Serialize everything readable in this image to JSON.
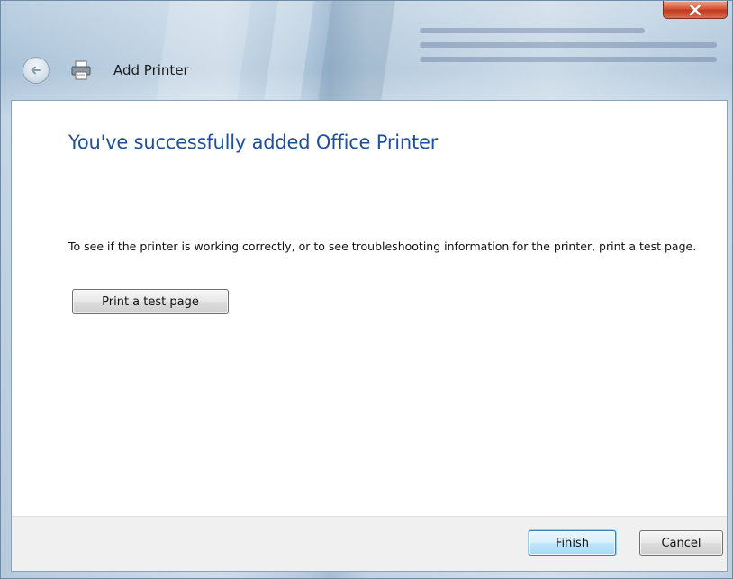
{
  "window": {
    "title": "Add Printer"
  },
  "content": {
    "heading": "You've successfully added Office Printer",
    "description": "To see if the printer is working correctly, or to see troubleshooting information for the printer, print a test page.",
    "test_page_button": "Print a test page"
  },
  "footer": {
    "finish_label": "Finish",
    "cancel_label": "Cancel"
  },
  "icons": {
    "close": "close-icon",
    "back": "back-arrow-icon",
    "printer": "printer-icon"
  },
  "colors": {
    "heading": "#1f4e9a",
    "close_button": "#d5573a"
  }
}
